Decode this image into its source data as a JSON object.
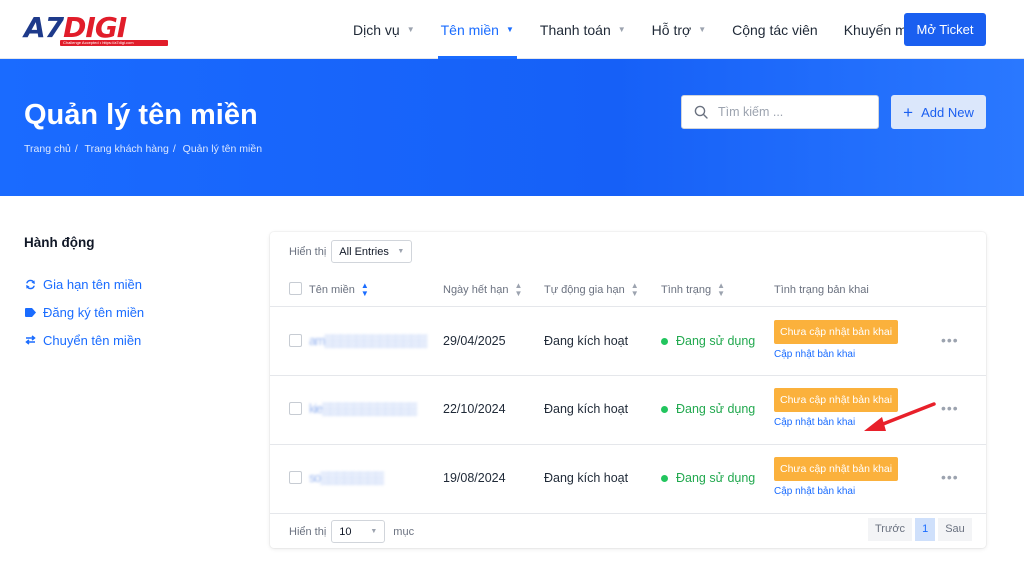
{
  "brand": {
    "logo_a7": "A7",
    "logo_digi": "DIGI",
    "logo_tagline": "Challenge Accepted • https://a7digi.com"
  },
  "nav": {
    "items": [
      {
        "label": "Dịch vụ",
        "dropdown": true,
        "active": false
      },
      {
        "label": "Tên miền",
        "dropdown": true,
        "active": true
      },
      {
        "label": "Thanh toán",
        "dropdown": true,
        "active": false
      },
      {
        "label": "Hỗ trợ",
        "dropdown": true,
        "active": false
      },
      {
        "label": "Cộng tác viên",
        "dropdown": false,
        "active": false
      },
      {
        "label": "Khuyến mãi",
        "dropdown": false,
        "active": false
      }
    ],
    "ticket_button": "Mở Ticket"
  },
  "hero": {
    "title": "Quản lý tên miền",
    "breadcrumb": [
      "Trang chủ",
      "Trang khách hàng",
      "Quản lý tên miền"
    ],
    "search_placeholder": "Tìm kiếm ...",
    "add_button": "Add New"
  },
  "sidebar": {
    "title": "Hành động",
    "items": [
      {
        "label": "Gia hạn tên miền",
        "icon": "refresh-icon"
      },
      {
        "label": "Đăng ký tên miền",
        "icon": "tag-icon"
      },
      {
        "label": "Chuyển tên miền",
        "icon": "transfer-icon"
      }
    ]
  },
  "table": {
    "show_label": "Hiển thị",
    "entries_select": "All Entries",
    "columns": [
      "Tên miền",
      "Ngày hết hạn",
      "Tự động gia hạn",
      "Tình trạng",
      "Tình trạng bản khai"
    ],
    "rows": [
      {
        "domain": "am▒▒▒▒▒▒▒▒▒▒▒▒▒",
        "expiry": "29/04/2025",
        "auto_renew": "Đang kích hoạt",
        "status": "Đang sử dụng",
        "deploy_badge": "Chưa cập nhật bản khai",
        "deploy_link": "Cập nhật bản khai"
      },
      {
        "domain": "kie▒▒▒▒▒▒▒▒▒▒▒▒",
        "expiry": "22/10/2024",
        "auto_renew": "Đang kích hoạt",
        "status": "Đang sử dụng",
        "deploy_badge": "Chưa cập nhật bản khai",
        "deploy_link": "Cập nhật bản khai"
      },
      {
        "domain": "so▒▒▒▒▒▒▒▒",
        "expiry": "19/08/2024",
        "auto_renew": "Đang kích hoạt",
        "status": "Đang sử dụng",
        "deploy_badge": "Chưa cập nhật bản khai",
        "deploy_link": "Cập nhật bản khai"
      }
    ],
    "footer_show_label": "Hiển thị",
    "page_size": "10",
    "page_size_suffix": "mục",
    "pager": {
      "prev": "Trước",
      "current": "1",
      "next": "Sau"
    }
  },
  "colors": {
    "primary": "#1a6cff",
    "hero": "#1660f7",
    "badge": "#fbb13c",
    "status_green": "#22c55e",
    "annotation_red": "#e8202a"
  }
}
